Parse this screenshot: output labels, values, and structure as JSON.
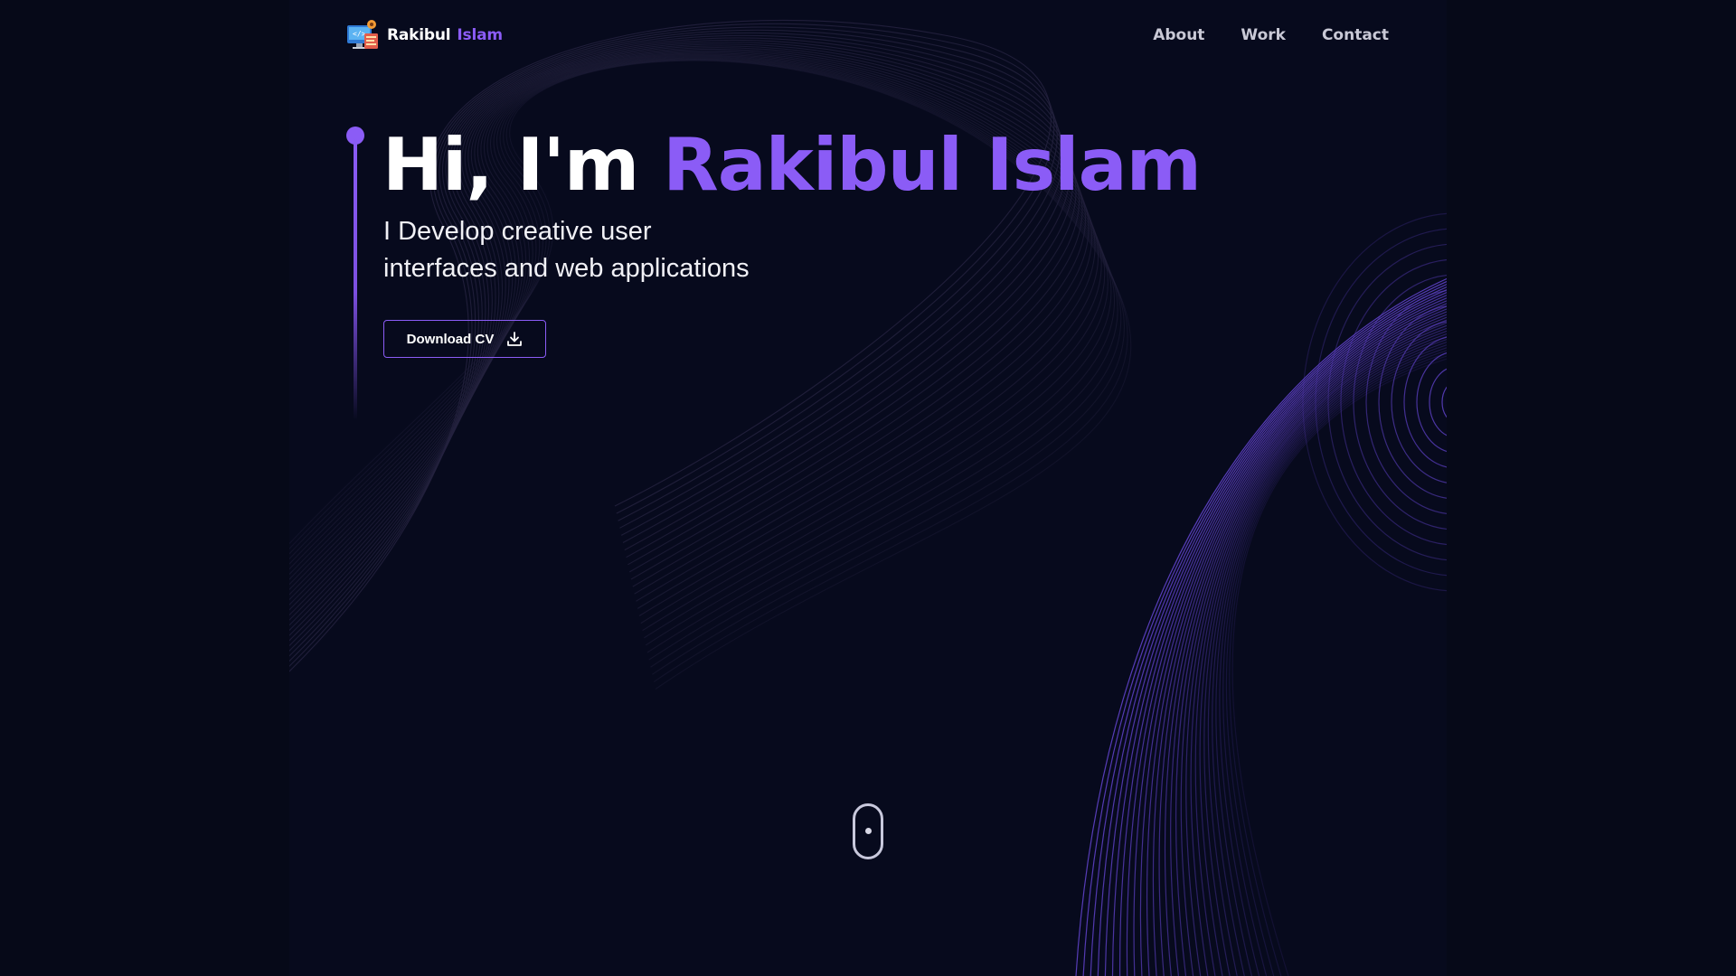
{
  "header": {
    "brand": {
      "first": "Rakibul",
      "last": "Islam",
      "logo_icon": "developer-monitor-icon"
    },
    "nav": [
      {
        "label": "About"
      },
      {
        "label": "Work"
      },
      {
        "label": "Contact"
      }
    ]
  },
  "hero": {
    "greeting": "Hi, I'm",
    "name": "Rakibul Islam",
    "tagline_line1": "I Develop creative user",
    "tagline_line2": "interfaces and web applications",
    "cv_button_label": "Download CV",
    "cv_button_icon": "download-icon"
  },
  "scroll_indicator": {
    "icon": "mouse-scroll-icon"
  },
  "colors": {
    "background": "#070a1d",
    "accent": "#8b5cf6",
    "text": "#ffffff",
    "nav_text": "#c9c9d6"
  }
}
